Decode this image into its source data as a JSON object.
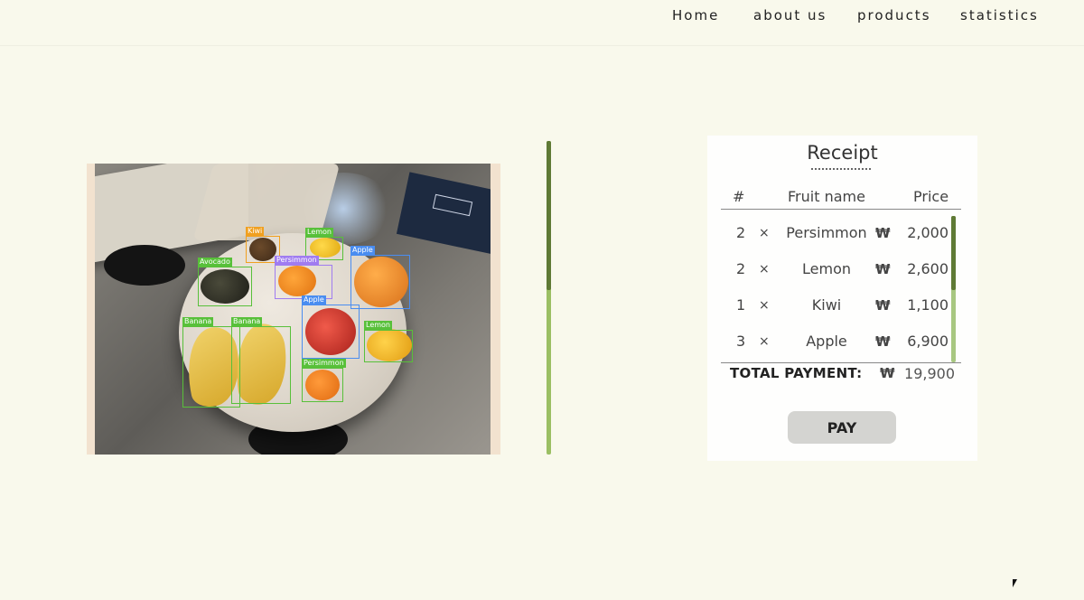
{
  "nav": {
    "items": [
      {
        "label": "Home"
      },
      {
        "label": "about us"
      },
      {
        "label": "products"
      },
      {
        "label": "statistics"
      }
    ]
  },
  "detection": {
    "labels": {
      "kiwi": "Kiwi",
      "lemon_top": "Lemon",
      "avocado": "Avocado",
      "persimmon": "Persimmon",
      "apple_right": "Apple",
      "banana_1": "Banana",
      "banana_2": "Banana",
      "apple": "Apple",
      "lemon_right": "Lemon",
      "persimmon_small": "Persimmon"
    },
    "colors": {
      "box_green": "#58c03a",
      "box_blue": "#4a8df0",
      "box_orange": "#f0a020",
      "box_purple": "#a07cf0"
    }
  },
  "divider": {
    "scroll_fraction": 0.48
  },
  "receipt": {
    "title": "Receipt",
    "headers": {
      "num": "#",
      "name": "Fruit name",
      "price": "Price"
    },
    "currency_symbol": "₩",
    "multiply_symbol": "×",
    "items": [
      {
        "qty": "2",
        "name": "Persimmon",
        "price": "2,000"
      },
      {
        "qty": "2",
        "name": "Lemon",
        "price": "2,600"
      },
      {
        "qty": "1",
        "name": "Kiwi",
        "price": "1,100"
      },
      {
        "qty": "3",
        "name": "Apple",
        "price": "6,900"
      }
    ],
    "total_label": "TOTAL PAYMENT:",
    "total_amount": "19,900",
    "pay_label": "PAY"
  },
  "colors": {
    "background": "#f9f9ec",
    "scroll_thumb": "#5f7a35",
    "scroll_track": "#9bbf63"
  }
}
